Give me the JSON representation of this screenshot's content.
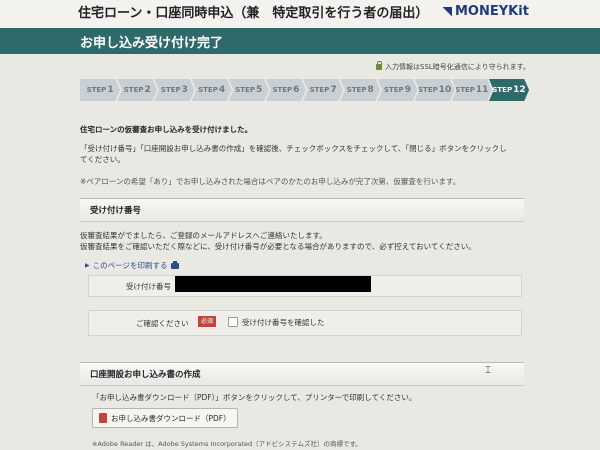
{
  "header": {
    "title": "住宅ローン・口座同時申込（兼　特定取引を行う者の届出）",
    "brand": "MONEYKit"
  },
  "page_title": "お申し込み受け付け完了",
  "ssl_notice": "入力情報はSSL暗号化通信により守られます。",
  "steps": {
    "prefix": "STEP",
    "items": [
      "1",
      "2",
      "3",
      "4",
      "5",
      "6",
      "7",
      "8",
      "9",
      "10",
      "11",
      "12"
    ],
    "active_index": 11
  },
  "intro": {
    "heading": "住宅ローンの仮審査お申し込みを受け付けました。",
    "line1": "「受け付け番号」「口座開設お申し込み書の作成」を確認後、チェックボックスをチェックして、「閉じる」ボタンをクリックし",
    "line2": "てください。",
    "note": "※ペアローンの希望「あり」でお申し込みされた場合はペアのかたのお申し込みが完了次第、仮審査を行います。"
  },
  "receipt_section": {
    "title": "受け付け番号",
    "desc1": "仮審査結果がでましたら、ご登録のメールアドレスへご連絡いたします。",
    "desc2": "仮審査結果をご確認いただく際などに、受け付け番号が必要となる場合がありますので、必ず控えておいてください。",
    "print_link": "このページを印刷する",
    "number_label": "受け付け番号",
    "confirm_label": "ご確認ください",
    "required_badge": "必須",
    "checkbox_label": "受け付け番号を確認した"
  },
  "account_section": {
    "title": "口座開設お申し込み書の作成",
    "desc": "「お申し込み書ダウンロード（PDF）」ボタンをクリックして、プリンターで印刷してください。",
    "download_button": "お申し込み書ダウンロード（PDF）",
    "footnote": "※Adobe Reader は、Adobe Systems Incorporated（アドビシステムズ社）の商標です。"
  }
}
